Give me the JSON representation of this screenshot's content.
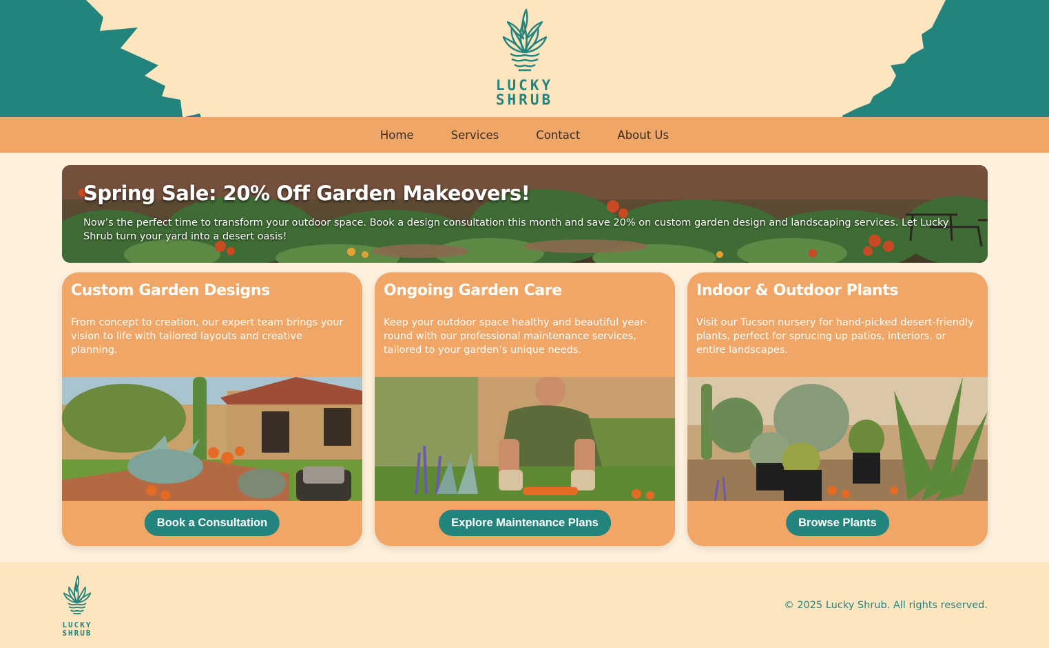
{
  "brand": {
    "line1": "LUCKY",
    "line2": "SHRUB"
  },
  "nav": {
    "items": [
      "Home",
      "Services",
      "Contact",
      "About Us"
    ]
  },
  "banner": {
    "title": "Spring Sale: 20% Off Garden Makeovers!",
    "text": "Now’s the perfect time to transform your outdoor space. Book a design consultation this month and save 20% on custom garden design and landscaping services. Let Lucky Shrub turn your yard into a desert oasis!"
  },
  "cards": [
    {
      "title": "Custom Garden Designs",
      "text": "From concept to creation, our expert team brings your vision to life with tailored layouts and creative planning.",
      "button": "Book a Consultation"
    },
    {
      "title": "Ongoing Garden Care",
      "text": "Keep your outdoor space healthy and beautiful year-round with our professional maintenance services, tailored to your garden’s unique needs.",
      "button": "Explore Maintenance Plans"
    },
    {
      "title": "Indoor & Outdoor Plants",
      "text": "Visit our Tucson nursery for hand-picked desert-friendly plants, perfect for sprucing up patios, interiors, or entire landscapes.",
      "button": "Browse Plants"
    }
  ],
  "footer": {
    "copyright": "© 2025 Lucky Shrub. All rights reserved."
  },
  "colors": {
    "teal": "#23837d",
    "orange": "#efa666",
    "cream": "#fde6bf"
  }
}
